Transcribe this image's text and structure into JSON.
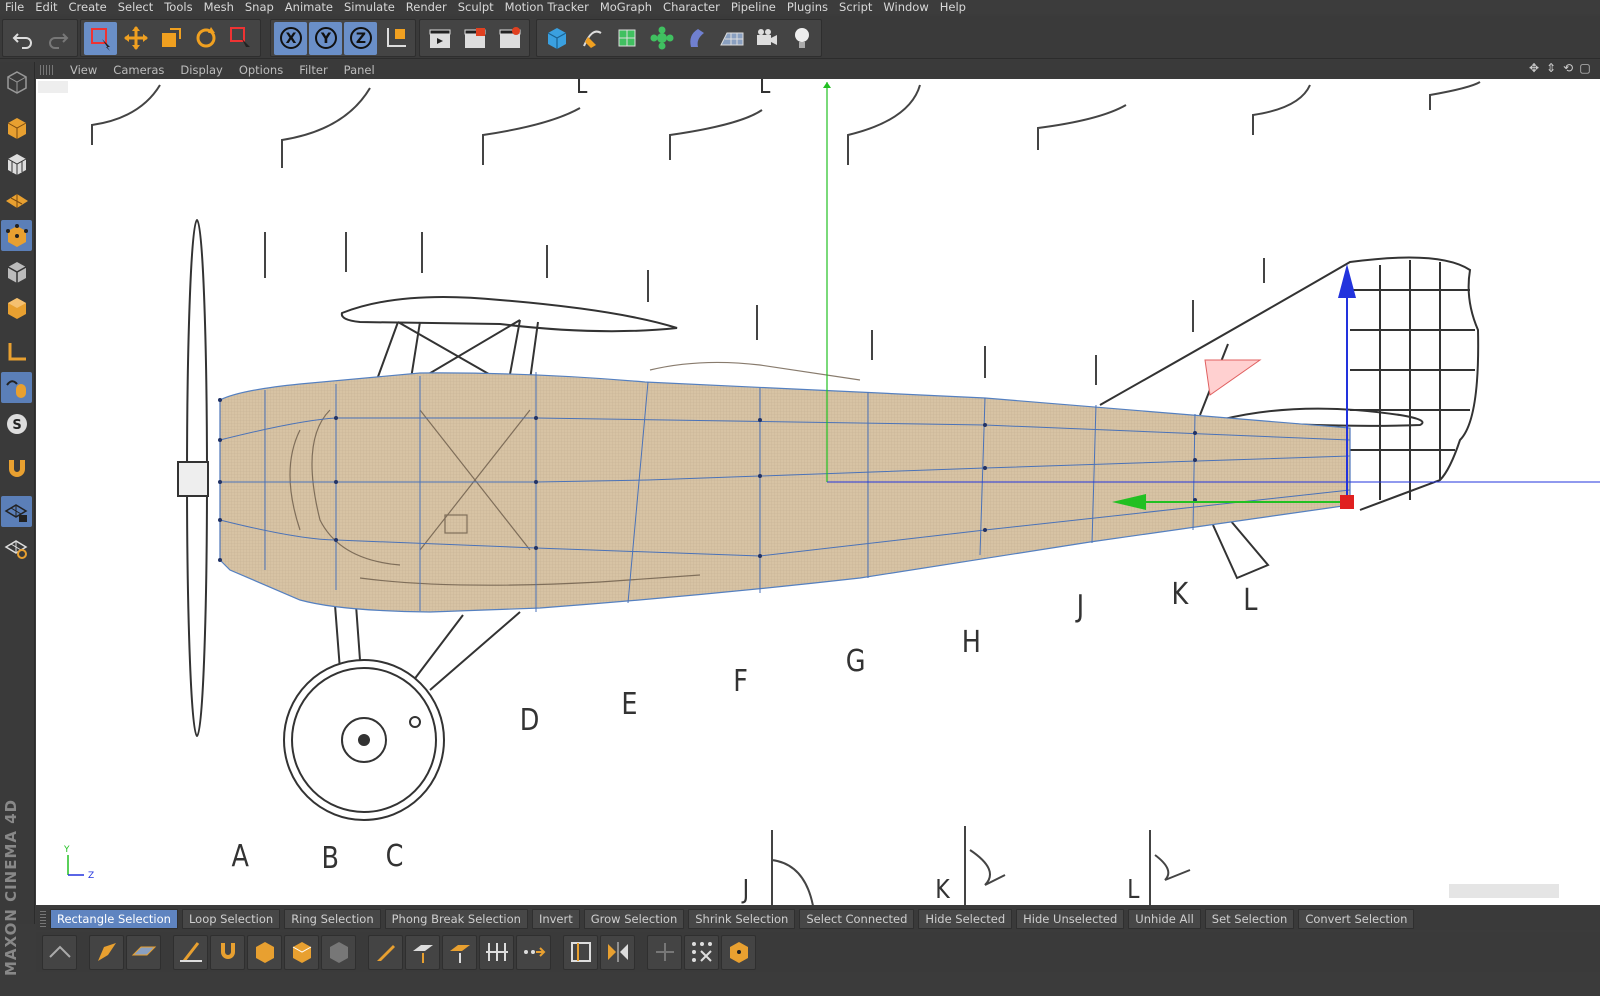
{
  "menu": [
    "File",
    "Edit",
    "Create",
    "Select",
    "Tools",
    "Mesh",
    "Snap",
    "Animate",
    "Simulate",
    "Render",
    "Sculpt",
    "Motion Tracker",
    "MoGraph",
    "Character",
    "Pipeline",
    "Plugins",
    "Script",
    "Window",
    "Help"
  ],
  "toolbar": {
    "undo": "undo-icon",
    "redo": "redo-icon",
    "axis_x": "X",
    "axis_y": "Y",
    "axis_z": "Z"
  },
  "viewport_menu": [
    "View",
    "Cameras",
    "Display",
    "Options",
    "Filter",
    "Panel"
  ],
  "blueprint_labels": [
    "A",
    "B",
    "C",
    "D",
    "E",
    "F",
    "G",
    "H",
    "J",
    "K",
    "L"
  ],
  "blueprint_top_labels": [
    "L",
    "L"
  ],
  "blueprint_bottom_labels": [
    "J",
    "K",
    "L"
  ],
  "axis_gizmo": {
    "y": "Y",
    "z": "Z"
  },
  "branding": "MAXON CINEMA 4D",
  "selection_tools": [
    "Rectangle Selection",
    "Loop Selection",
    "Ring Selection",
    "Phong Break Selection",
    "Invert",
    "Grow Selection",
    "Shrink Selection",
    "Select Connected",
    "Hide Selected",
    "Hide Unselected",
    "Unhide All",
    "Set Selection",
    "Convert Selection"
  ],
  "colors": {
    "accent": "#5f84c0",
    "fuselage": "#d9c6a8",
    "axis_x": "#e02020",
    "axis_y": "#22c022",
    "axis_z": "#2233dd",
    "panel": "#3a3a3a"
  }
}
